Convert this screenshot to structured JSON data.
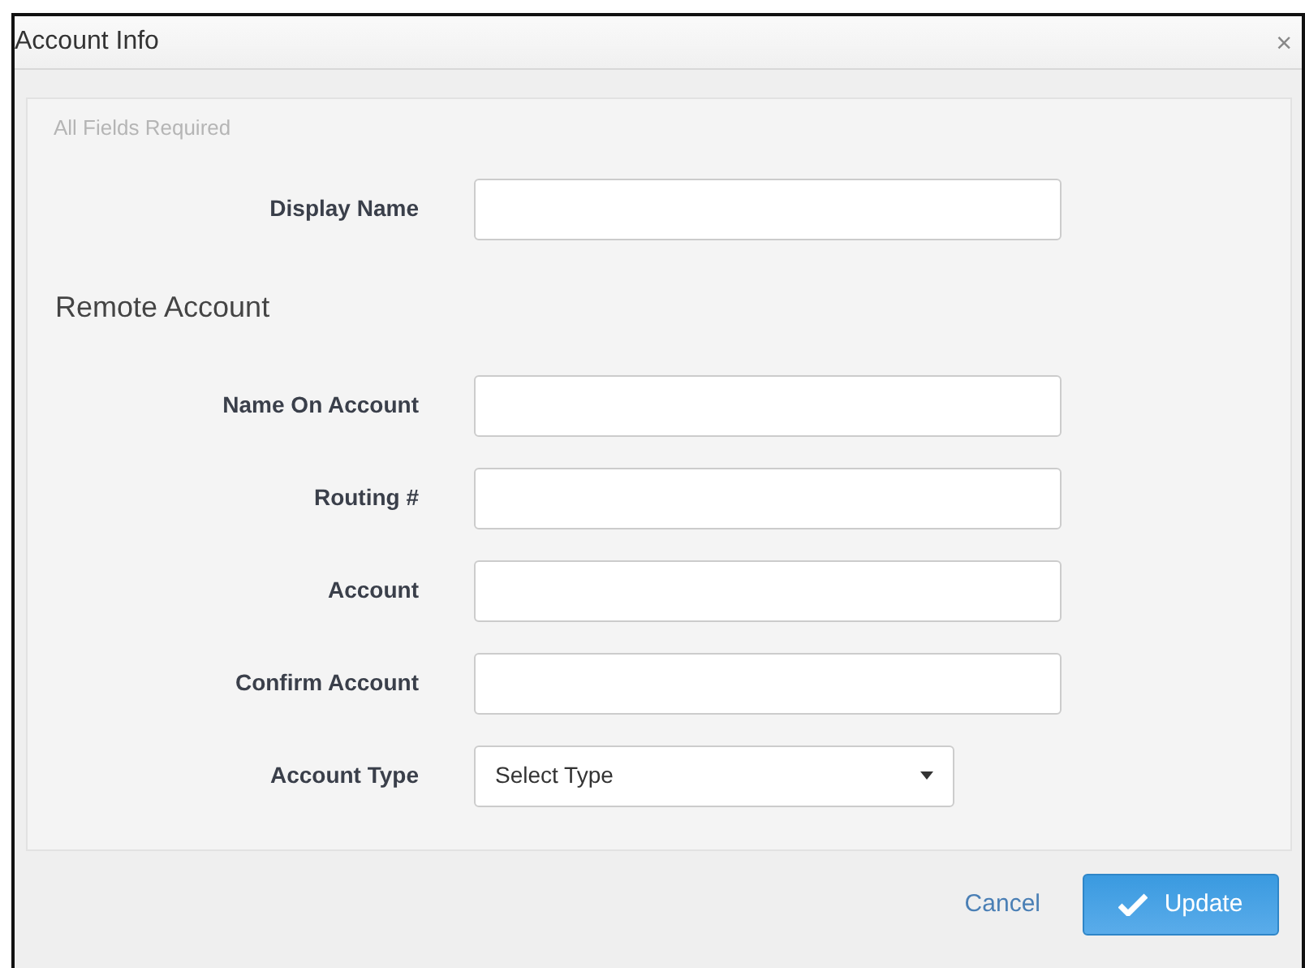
{
  "dialog": {
    "title": "Account Info",
    "close": "×"
  },
  "note": "All Fields Required",
  "display_name": {
    "label": "Display Name"
  },
  "section": "Remote Account",
  "fields": [
    {
      "kind": "text",
      "label": "Name On Account"
    },
    {
      "kind": "text",
      "label": "Routing #"
    },
    {
      "kind": "text",
      "label": "Account"
    },
    {
      "kind": "text",
      "label": "Confirm Account"
    },
    {
      "kind": "select",
      "label": "Account Type",
      "value": "Select Type"
    }
  ],
  "footer": {
    "cancel": "Cancel",
    "submit": "Update"
  }
}
